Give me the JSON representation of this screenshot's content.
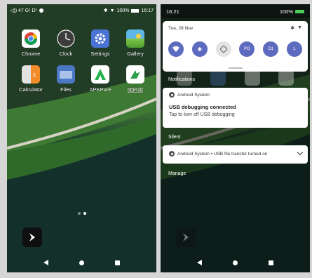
{
  "left_phone": {
    "status": {
      "left_text": "◁)) 47  G¹  D¹",
      "right_text": "100%",
      "time": "16:17"
    },
    "apps": [
      {
        "label": "Chrome",
        "icon": "chrome-icon"
      },
      {
        "label": "Clock",
        "icon": "clock-icon"
      },
      {
        "label": "Settings",
        "icon": "settings-gear-icon"
      },
      {
        "label": "Gallery",
        "icon": "gallery-icon"
      },
      {
        "label": "Calculator",
        "icon": "calculator-icon"
      },
      {
        "label": "Files",
        "icon": "files-icon"
      },
      {
        "label": "APKPure",
        "icon": "apkpure-icon"
      },
      {
        "label": "図目説",
        "icon": "green-app-icon"
      }
    ],
    "page_count": 2,
    "current_page": 2
  },
  "right_phone": {
    "status": {
      "time": "16:21",
      "battery": "100%"
    },
    "quick_settings": {
      "date": "Tue, 28 Nov",
      "tiles": [
        {
          "label": "",
          "icon": "wifi-icon",
          "active": true
        },
        {
          "label": "",
          "icon": "bluetooth-icon",
          "active": true
        },
        {
          "label": "",
          "icon": "rotate-icon",
          "active": false
        },
        {
          "label": "PO",
          "icon": "",
          "active": true
        },
        {
          "label": "D1",
          "icon": "",
          "active": true
        },
        {
          "label": "L",
          "icon": "",
          "active": true
        }
      ]
    },
    "notifications_header": "Notifications",
    "notification": {
      "app": "Android System",
      "title": "USB debugging connected",
      "body": "Tap to turn off USB debugging"
    },
    "silent_header": "Silent",
    "silent_notification": "Android System • USB file transfer turned on",
    "manage_label": "Manage"
  },
  "colors": {
    "tile_active": "#5c6bc0",
    "battery_green": "#4ccf59"
  }
}
